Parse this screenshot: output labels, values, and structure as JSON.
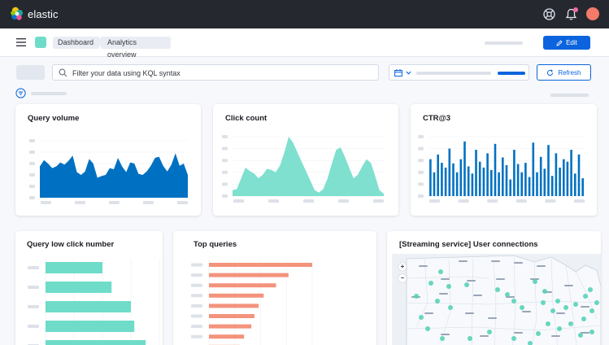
{
  "app": {
    "name": "elastic",
    "colors": {
      "topbar": "#25282f",
      "accent": "#0b64dd",
      "teal": "#6fdcc9",
      "blue_chart": "#0071c2",
      "salmon": "#f4937c",
      "avatar": "#f47b6a"
    }
  },
  "header": {
    "breadcrumbs": [
      "Dashboard",
      "Analytics overview"
    ],
    "edit_label": "Edit"
  },
  "query_bar": {
    "placeholder": "Filter your data using KQL syntax",
    "refresh_label": "Refresh"
  },
  "panels": {
    "query_volume": {
      "title": "Query volume"
    },
    "click_count": {
      "title": "Click count"
    },
    "ctr": {
      "title": "CTR@3"
    },
    "low_click": {
      "title": "Query low click number"
    },
    "top_queries": {
      "title": "Top queries"
    },
    "user_connections": {
      "title": "[Streaming service] User connections"
    }
  },
  "chart_data": [
    {
      "type": "area",
      "panel": "Query volume",
      "color": "#0071c2",
      "values": [
        0.55,
        0.66,
        0.6,
        0.52,
        0.55,
        0.62,
        0.58,
        0.65,
        0.74,
        0.45,
        0.4,
        0.46,
        0.68,
        0.6,
        0.35,
        0.38,
        0.4,
        0.52,
        0.5,
        0.7,
        0.55,
        0.45,
        0.62,
        0.6,
        0.42,
        0.4,
        0.46,
        0.56,
        0.7,
        0.72,
        0.56,
        0.46,
        0.58,
        0.78,
        0.56,
        0.6,
        0.4
      ]
    },
    {
      "type": "area",
      "panel": "Click count",
      "color": "#7fe0cf",
      "values": [
        0.1,
        0.12,
        0.3,
        0.48,
        0.42,
        0.38,
        0.3,
        0.36,
        0.46,
        0.44,
        0.4,
        0.52,
        0.74,
        1.0,
        0.9,
        0.74,
        0.58,
        0.42,
        0.26,
        0.1,
        0.06,
        0.12,
        0.3,
        0.55,
        0.78,
        0.82,
        0.66,
        0.48,
        0.3,
        0.36,
        0.5,
        0.62,
        0.56,
        0.34,
        0.1,
        0.04
      ]
    },
    {
      "type": "bar",
      "panel": "CTR@3",
      "color": "#0071c2",
      "values": [
        0.62,
        0.4,
        0.7,
        0.56,
        0.48,
        0.8,
        0.55,
        0.4,
        0.62,
        0.92,
        0.5,
        0.38,
        0.78,
        0.58,
        0.48,
        0.72,
        0.44,
        0.88,
        0.4,
        0.65,
        0.52,
        0.28,
        0.78,
        0.54,
        0.4,
        0.56,
        0.32,
        0.9,
        0.4,
        0.66,
        0.46,
        0.86,
        0.34,
        0.72,
        0.48,
        0.62,
        0.58,
        0.78,
        0.38,
        0.7,
        0.3
      ]
    },
    {
      "type": "bar",
      "orientation": "horizontal",
      "panel": "Query low click number",
      "color": "#6fdcc9",
      "values": [
        0.5,
        0.58,
        0.75,
        0.78,
        0.88
      ]
    },
    {
      "type": "bar",
      "orientation": "horizontal",
      "panel": "Top queries",
      "color": "#f4937c",
      "values": [
        1.0,
        0.77,
        0.65,
        0.53,
        0.48,
        0.44,
        0.41,
        0.34,
        0.3
      ]
    }
  ],
  "map": {
    "zoom_in_label": "+",
    "zoom_out_label": "−",
    "point_color": "#58d1b8"
  }
}
